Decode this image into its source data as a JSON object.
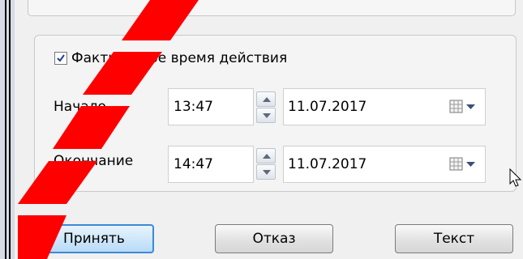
{
  "group": {
    "checkbox": {
      "label": "Фактическое время действия",
      "checked": true
    },
    "start": {
      "label": "Начало",
      "time": "13:47",
      "date": "11.07.2017"
    },
    "end": {
      "label": "Окончание",
      "time": "14:47",
      "date": "11.07.2017"
    }
  },
  "buttons": {
    "accept": "Принять",
    "cancel": "Отказ",
    "text": "Текст"
  },
  "colors": {
    "annotation_stripes": "#ff0000",
    "default_button_border": "#3b8ad8"
  },
  "icons": [
    "checkmark-icon",
    "spin-up-icon",
    "spin-down-icon",
    "calendar-icon",
    "dropdown-arrow-icon",
    "mouse-cursor-icon"
  ]
}
